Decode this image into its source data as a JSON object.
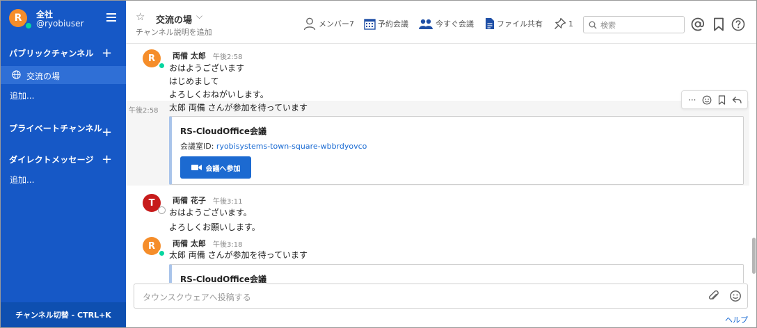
{
  "sidebar": {
    "team_name": "全社",
    "username": "@ryobiuser",
    "avatar_initial": "R",
    "public_channels_label": "パブリックチャンネル",
    "active_channel": "交流の場",
    "add_public": "追加...",
    "private_channels_label": "プライベートチャンネル",
    "direct_messages_label": "ダイレクトメッセージ",
    "add_dm": "追加...",
    "channel_switcher": "チャンネル切替 - CTRL+K"
  },
  "header": {
    "channel_title": "交流の場",
    "channel_description": "チャンネル説明を追加",
    "members_label": "メンバー",
    "members_count": "7",
    "reserve_meeting": "予約会議",
    "instant_meeting": "今すぐ会議",
    "file_share": "ファイル共有",
    "pinned_count": "1",
    "search_placeholder": "検索"
  },
  "messages": [
    {
      "avatar_initial": "R",
      "author": "両備 太郎",
      "time": "午後2:58",
      "lines": [
        "おはようございます",
        "はじめまして",
        "よろしくおねがいします。"
      ]
    },
    {
      "time": "午後2:58",
      "text": "太郎 両備 さんが参加を待っています",
      "card": {
        "title": "RS-CloudOffice会議",
        "room_label": "会議室ID: ",
        "room_id": "ryobisystems-town-square-wbbrdyovco",
        "join_label": "会議へ参加"
      }
    },
    {
      "avatar_initial": "T",
      "author": "両備 花子",
      "time": "午後3:11",
      "lines": [
        "おはようございます。",
        "よろしくお願いします。"
      ]
    },
    {
      "avatar_initial": "R",
      "author": "両備 太郎",
      "time": "午後3:18",
      "text": "太郎 両備 さんが参加を待っています",
      "card": {
        "title": "RS-CloudOffice会議"
      }
    }
  ],
  "post_input": {
    "placeholder": "タウンスクウェアへ投稿する"
  },
  "help_link": "ヘルプ",
  "colors": {
    "sidebar_bg": "#1658c6",
    "accent": "#1c6ad1",
    "avatar_orange": "#f58d2a",
    "avatar_red": "#c71b1b",
    "online": "#06d6a0"
  }
}
